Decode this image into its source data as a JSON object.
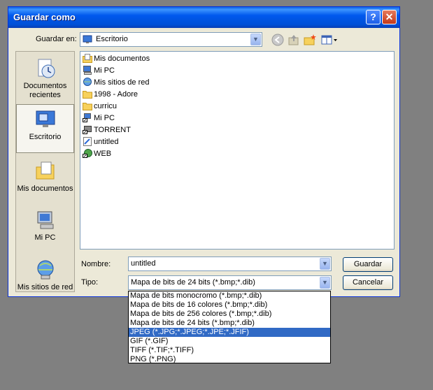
{
  "window": {
    "title": "Guardar como",
    "help_label": "?",
    "close_label": "✕"
  },
  "toolbar": {
    "save_in_label": "Guardar en:",
    "save_in_value": "Escritorio",
    "icons": [
      "back-icon",
      "up-folder-icon",
      "new-folder-icon",
      "view-menu-icon"
    ]
  },
  "places": [
    {
      "label": "Documentos recientes",
      "icon": "recent-documents-icon"
    },
    {
      "label": "Escritorio",
      "icon": "desktop-icon",
      "selected": true
    },
    {
      "label": "Mis documentos",
      "icon": "my-documents-icon"
    },
    {
      "label": "Mi PC",
      "icon": "my-computer-icon"
    },
    {
      "label": "Mis sitios de red",
      "icon": "network-places-icon"
    }
  ],
  "files": [
    {
      "name": "Mis documentos",
      "icon": "my-documents-icon"
    },
    {
      "name": "Mi PC",
      "icon": "my-computer-icon"
    },
    {
      "name": "Mis sitios de red",
      "icon": "network-places-icon"
    },
    {
      "name": "1998 - Adore",
      "icon": "folder-icon"
    },
    {
      "name": "curricu",
      "icon": "folder-icon"
    },
    {
      "name": "Mi PC",
      "icon": "shortcut-icon"
    },
    {
      "name": "TORRENT",
      "icon": "shortcut-icon"
    },
    {
      "name": "untitled",
      "icon": "image-file-icon"
    },
    {
      "name": "WEB",
      "icon": "globe-shortcut-icon"
    }
  ],
  "form": {
    "name_label": "Nombre:",
    "name_value": "untitled",
    "type_label": "Tipo:",
    "type_value": "Mapa de bits de 24 bits (*.bmp;*.dib)",
    "save_button": "Guardar",
    "cancel_button": "Cancelar"
  },
  "type_options": [
    "Mapa de bits monocromo (*.bmp;*.dib)",
    "Mapa de bits de 16 colores (*.bmp;*.dib)",
    "Mapa de bits de 256 colores (*.bmp;*.dib)",
    "Mapa de bits de 24 bits (*.bmp;*.dib)",
    "JPEG (*.JPG;*.JPEG;*.JPE;*.JFIF)",
    "GIF (*.GIF)",
    "TIFF (*.TIF;*.TIFF)",
    "PNG (*.PNG)"
  ],
  "type_selected_index": 4,
  "colors": {
    "titlebar": "#0058ee",
    "dialog_bg": "#ece9d8",
    "selection": "#316ac5",
    "desktop": "#808080"
  }
}
